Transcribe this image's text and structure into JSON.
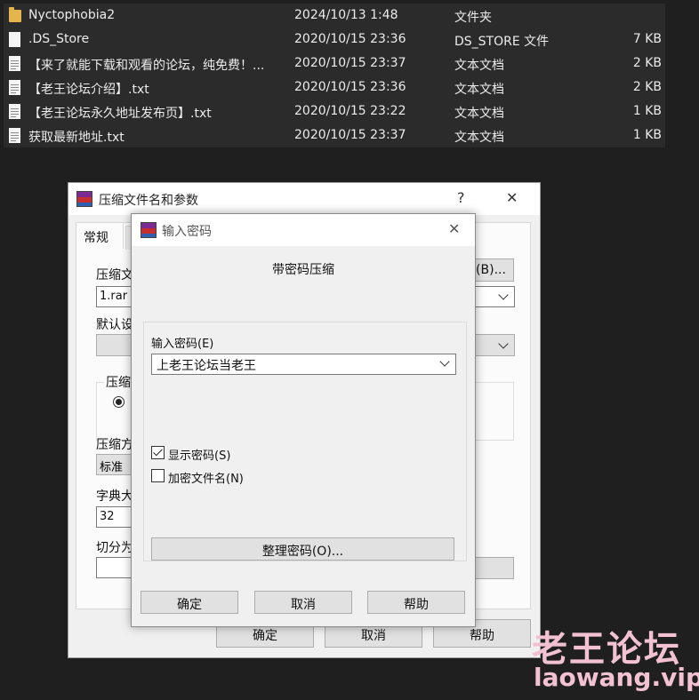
{
  "files": [
    {
      "icon": "folder-icon",
      "name": "Nyctophobia2",
      "date": "2024/10/13 1:48",
      "type": "文件夹",
      "size": ""
    },
    {
      "icon": "file-icon",
      "name": ".DS_Store",
      "date": "2020/10/15 23:36",
      "type": "DS_STORE 文件",
      "size": "7 KB"
    },
    {
      "icon": "text-file-icon",
      "name": "【来了就能下载和观看的论坛，纯免费！...",
      "date": "2020/10/15 23:37",
      "type": "文本文档",
      "size": "2 KB"
    },
    {
      "icon": "text-file-icon",
      "name": "【老王论坛介绍】.txt",
      "date": "2020/10/15 23:36",
      "type": "文本文档",
      "size": "2 KB"
    },
    {
      "icon": "text-file-icon",
      "name": "【老王论坛永久地址发布页】.txt",
      "date": "2020/10/15 23:22",
      "type": "文本文档",
      "size": "1 KB"
    },
    {
      "icon": "text-file-icon",
      "name": "获取最新地址.txt",
      "date": "2020/10/15 23:37",
      "type": "文本文档",
      "size": "1 KB"
    }
  ],
  "archive_dialog": {
    "title": "压缩文件名和参数",
    "help_button": "?",
    "close_button": "✕",
    "tab_general": "常规",
    "archive_name_label": "压缩文",
    "archive_name_value": "1.rar",
    "browse_button": "(B)...",
    "default_label": "默认设",
    "format_group_label": "压缩",
    "method_label": "压缩方",
    "method_value": "标准",
    "dict_label": "字典大",
    "dict_value": "32",
    "split_label": "切分为",
    "right_paren": ")",
    "ok_button": "确定",
    "cancel_button": "取消",
    "help_button_bottom": "帮助"
  },
  "password_dialog": {
    "title": "输入密码",
    "close_button": "✕",
    "heading": "带密码压缩",
    "password_label": "输入密码(E)",
    "password_value": "上老王论坛当老王",
    "show_password_label": "显示密码(S)",
    "show_password_checked": true,
    "encrypt_names_label": "加密文件名(N)",
    "encrypt_names_checked": false,
    "organize_button": "整理密码(O)...",
    "ok_button": "确定",
    "cancel_button": "取消",
    "help_button": "帮助"
  },
  "watermark": {
    "chinese": "老王论坛",
    "url": "laowang.vip"
  }
}
